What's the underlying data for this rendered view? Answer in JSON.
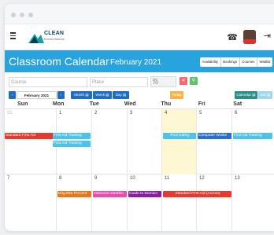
{
  "header": {
    "logo_text": "CLEAN",
    "logo_sub": "Environmental"
  },
  "banner": {
    "title": "Classroom Calendar",
    "month": "February 2021"
  },
  "view_tabs": [
    "Availability",
    "Bookings",
    "Courses",
    "Waitlist"
  ],
  "filters": {
    "course_placeholder": "Course",
    "place_placeholder": "Place",
    "max_label": "Max",
    "max_value": "70"
  },
  "nav": {
    "current": "February 2021",
    "month": "Month",
    "week": "Week",
    "day": "Day",
    "today": "Today",
    "calendar": "Calendar",
    "list": "List"
  },
  "weekdays": [
    "Sun",
    "Mon",
    "Tue",
    "Wed",
    "Thu",
    "Fri",
    "Sat"
  ],
  "weeks": [
    {
      "days": [
        "31",
        "1",
        "2",
        "3",
        "4",
        "5",
        "6"
      ]
    },
    {
      "days": [
        "7",
        "8",
        "9",
        "10",
        "11",
        "12",
        "13"
      ]
    }
  ],
  "events": [
    {
      "title": "Standard First Aid",
      "color": "#e8392f"
    },
    {
      "title": "First Aid Training",
      "color": "#4cc3ea"
    },
    {
      "title": "First Aid Training",
      "color": "#4cc3ea"
    },
    {
      "title": "Pool Safety",
      "color": "#4cc3ea"
    },
    {
      "title": "Computer Works",
      "color": "#2a6fd0"
    },
    {
      "title": "First Aid Training",
      "color": "#4cc3ea"
    },
    {
      "title": "Dog Bite Prevent",
      "color": "#e8761a"
    },
    {
      "title": "Instructor Dashbo",
      "color": "#e94bb0"
    },
    {
      "title": "Guide to Domino",
      "color": "#8b1da3"
    },
    {
      "title": "Standard First Aid (Aurora)",
      "color": "#e8392f"
    }
  ],
  "colors": {
    "brand": "#29a3dd",
    "today_bg": "#fdf7d4",
    "nav_blue": "#1f6cc0",
    "today_btn": "#f2b44b",
    "red_btn": "#f06b6b",
    "green_btn": "#5fc36b",
    "calendar_btn": "#2c8f86",
    "list_btn": "#9fd7ef"
  }
}
